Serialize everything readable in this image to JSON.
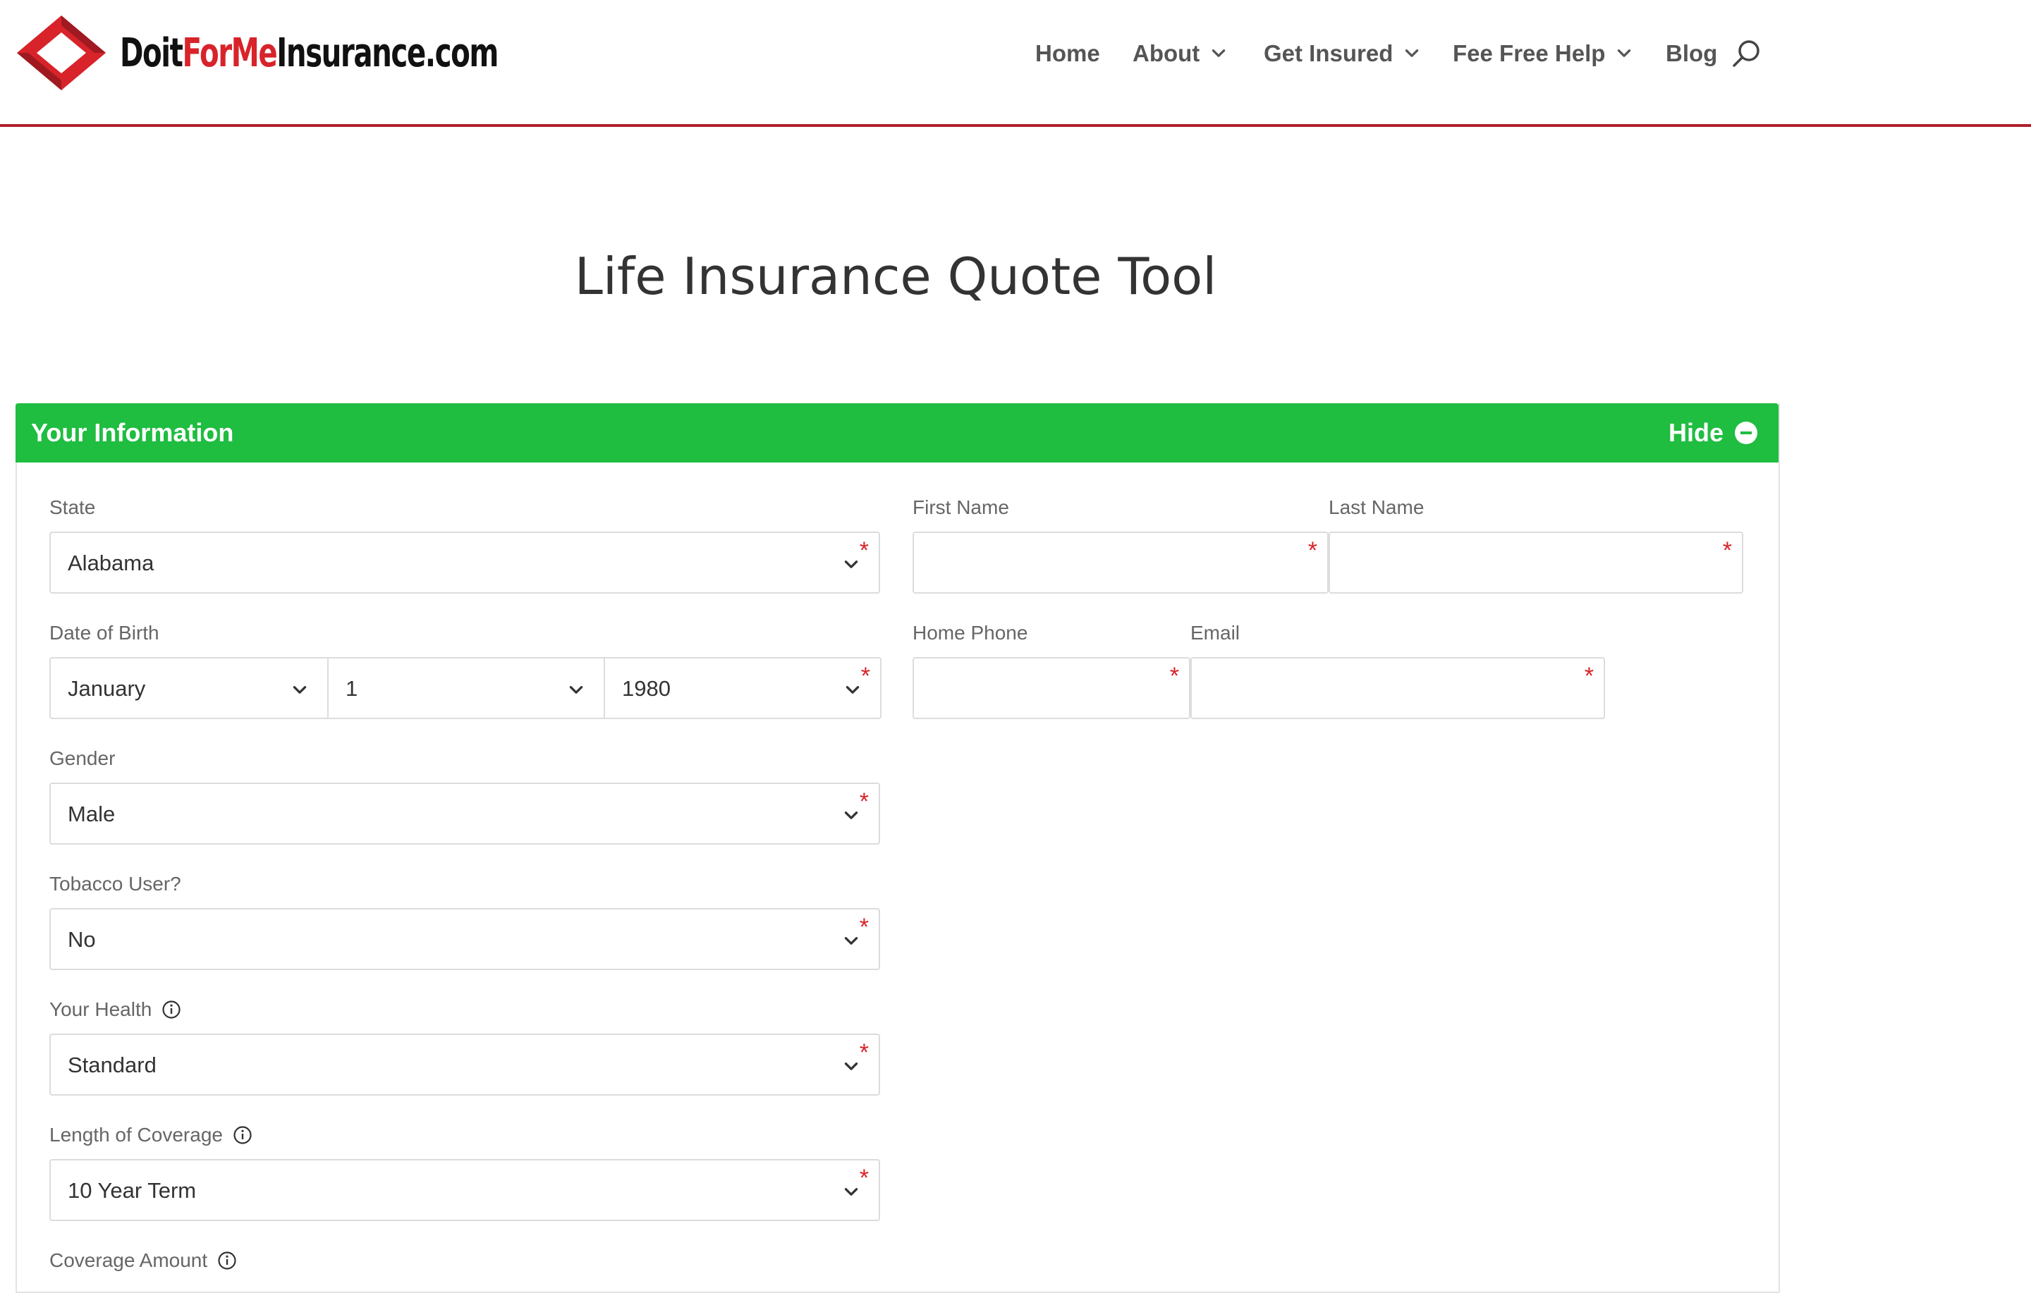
{
  "header": {
    "logo": {
      "part1": "Doit",
      "part2": "ForMe",
      "part3": "Insurance.com"
    },
    "nav": [
      {
        "label": "Home",
        "has_dropdown": false
      },
      {
        "label": "About",
        "has_dropdown": true
      },
      {
        "label": "Get Insured",
        "has_dropdown": true
      },
      {
        "label": "Fee Free Help",
        "has_dropdown": true
      },
      {
        "label": "Blog",
        "has_dropdown": false
      }
    ],
    "search_icon": "search-icon"
  },
  "page_title": "Life Insurance Quote Tool",
  "panel": {
    "title": "Your Information",
    "hide_label": "Hide",
    "fields": {
      "state": {
        "label": "State",
        "value": "Alabama"
      },
      "dob": {
        "label": "Date of Birth",
        "month": "January",
        "day": "1",
        "year": "1980"
      },
      "gender": {
        "label": "Gender",
        "value": "Male"
      },
      "tobacco": {
        "label": "Tobacco User?",
        "value": "No"
      },
      "health": {
        "label": "Your Health",
        "value": "Standard"
      },
      "coverage_length": {
        "label": "Length of Coverage",
        "value": "10 Year Term"
      },
      "coverage_amount": {
        "label": "Coverage Amount"
      },
      "first_name": {
        "label": "First Name",
        "value": ""
      },
      "last_name": {
        "label": "Last Name",
        "value": ""
      },
      "home_phone": {
        "label": "Home Phone",
        "value": ""
      },
      "email": {
        "label": "Email",
        "value": ""
      }
    },
    "required_marker": "*"
  },
  "colors": {
    "accent_green": "#1fbd40",
    "brand_red": "#d8232a",
    "header_rule": "#b0202a"
  }
}
